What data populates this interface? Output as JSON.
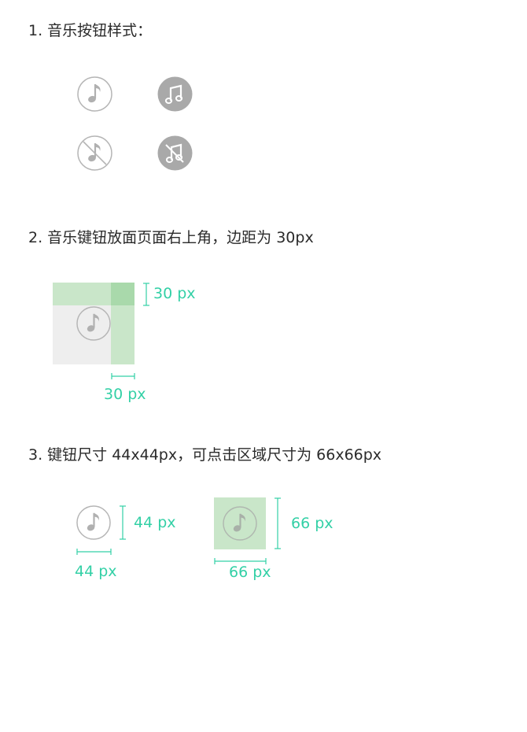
{
  "sections": [
    {
      "title": "1. 音乐按钮样式："
    },
    {
      "title": "2. 音乐键钮放面页面右上角，边距为 30px"
    },
    {
      "title": "3. 键钮尺寸 44x44px，可点击区域尺寸为 66x66px"
    }
  ],
  "icons": {
    "row1": [
      "music-note-outline-icon",
      "music-notes-filled-icon"
    ],
    "row2": [
      "music-note-muted-outline-icon",
      "music-notes-muted-filled-icon"
    ]
  },
  "margin_demo": {
    "top_label": "30 px",
    "bottom_label": "30 px"
  },
  "size_demo": {
    "button_height_label": "44 px",
    "button_width_label": "44 px",
    "hit_height_label": "66 px",
    "hit_width_label": "66 px"
  },
  "colors": {
    "accent": "#33d0a6",
    "margin_fill": "#c9e6c9",
    "margin_overlap": "#a9d9ab",
    "page_fill": "#eeeeee",
    "icon_gray": "#b5b5b5",
    "icon_filled": "#a9a9a9"
  }
}
